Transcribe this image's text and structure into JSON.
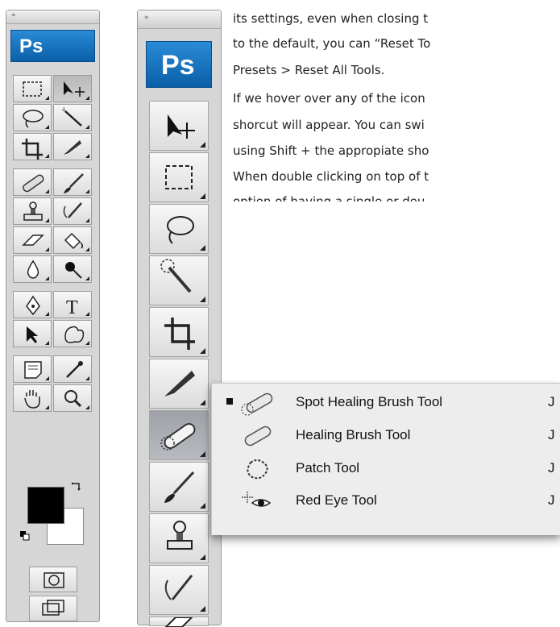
{
  "paragraph_lines": [
    "its settings, even when closing t",
    "to the default, you can “Reset To",
    "Presets > Reset All Tools.",
    "If we hover over any of the icon",
    "shorcut will appear. You can swi",
    "using Shift + the appropiate sho",
    "When double clicking on top of t",
    "option of having  a single or dou"
  ],
  "toolbar_double": {
    "logo": "Ps",
    "grip": "«"
  },
  "toolbar_single": {
    "logo": "Ps",
    "grip": "»"
  },
  "flyout": {
    "items": [
      {
        "label": "Spot Healing Brush Tool",
        "shortcut": "J",
        "selected": true,
        "icon": "spot-healing-brush-icon"
      },
      {
        "label": "Healing Brush Tool",
        "shortcut": "J",
        "selected": false,
        "icon": "healing-brush-icon"
      },
      {
        "label": "Patch Tool",
        "shortcut": "J",
        "selected": false,
        "icon": "patch-icon"
      },
      {
        "label": "Red Eye Tool",
        "shortcut": "J",
        "selected": false,
        "icon": "red-eye-icon"
      }
    ]
  },
  "colors": {
    "foreground": "#000000",
    "background": "#ffffff",
    "ps_blue": "#0a5fa8"
  }
}
